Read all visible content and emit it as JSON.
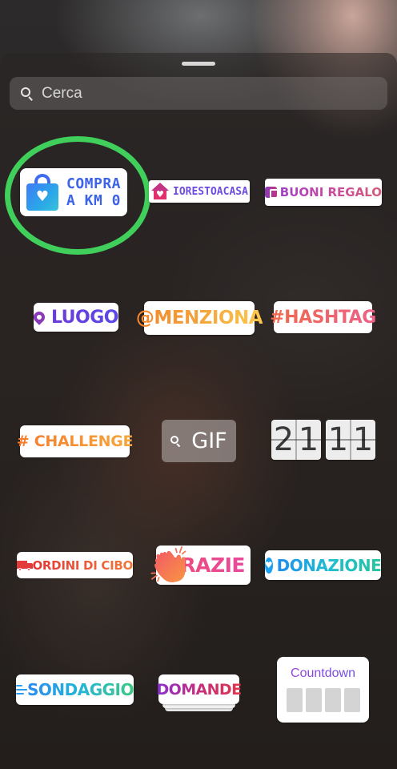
{
  "search": {
    "placeholder": "Cerca"
  },
  "stickers": {
    "compra": {
      "line1": "COMPRA",
      "line2": "A KM 0"
    },
    "iorestoacasa": {
      "label": "IORESTOACASA"
    },
    "buoni_regalo": {
      "label": "BUONI REGALO"
    },
    "luogo": {
      "label": "LUOGO"
    },
    "menziona": {
      "label": "@MENZIONA"
    },
    "hashtag": {
      "label": "#HASHTAG"
    },
    "challenge": {
      "label": "# CHALLENGE"
    },
    "gif": {
      "label": "GIF"
    },
    "time": {
      "h1": "2",
      "h2": "1",
      "m1": "1",
      "m2": "1"
    },
    "ordini_di_cibo": {
      "label": "ORDINI DI CIBO"
    },
    "grazie": {
      "label": "GRAZIE"
    },
    "donazione": {
      "label": "DONAZIONE"
    },
    "sondaggio": {
      "label": "SONDAGGIO"
    },
    "domande": {
      "label": "DOMANDE"
    },
    "countdown": {
      "label": "Countdown"
    }
  },
  "icons": {
    "search": "search-icon",
    "shopping_bag": "shopping-bag-icon",
    "house": "house-icon",
    "gift_card": "gift-card-icon",
    "location_pin": "location-pin-icon",
    "gif_search": "search-icon",
    "delivery_truck": "delivery-truck-icon",
    "clapping_hands": "clapping-hands-icon",
    "donation_heart": "heart-icon",
    "poll": "poll-lines-icon"
  },
  "colors": {
    "highlight_circle": "#3fcf5a",
    "compra_blue": "#3d63e8",
    "donazione_blue": "#1ba1f2"
  }
}
